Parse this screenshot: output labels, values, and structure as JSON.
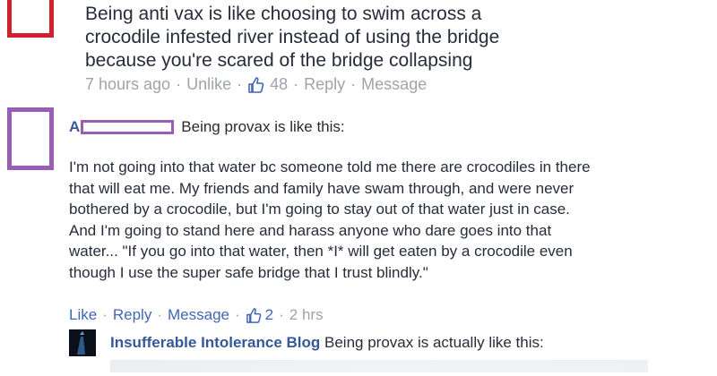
{
  "comment1": {
    "lines": [
      "Being anti vax is like choosing to swim across a",
      "crocodile infested river instead of using the bridge",
      "because you're scared of the bridge collapsing"
    ],
    "time": "7 hours ago",
    "unlike": "Unlike",
    "likes": "48",
    "reply": "Reply",
    "message": "Message"
  },
  "comment2": {
    "author_initial": "A",
    "headline": "Being provax is like this:",
    "lines": [
      "I'm not going into that water bc someone told me there are crocodiles in there",
      "that will eat me. My friends and family have swam through, and were never",
      "bothered by a crocodile, but I'm going to stay out of that water just in case.",
      "And I'm going to stand here and harass anyone who dare goes into that",
      "water... \"If you go into that water, then *I* will get eaten by a crocodile even",
      "though I use the super safe bridge that I trust blindly.\""
    ],
    "like": "Like",
    "reply": "Reply",
    "message": "Message",
    "likes": "2",
    "time": "2 hrs"
  },
  "reply": {
    "author": "Insufferable Intolerance Blog",
    "text": "Being provax is actually like this:"
  },
  "colors": {
    "link": "#365899",
    "meta": "#9ea4ad",
    "avatar1_border": "#d0212c",
    "avatar2_border": "#9a5db6"
  },
  "icons": {
    "like": "thumbs-up-icon"
  }
}
